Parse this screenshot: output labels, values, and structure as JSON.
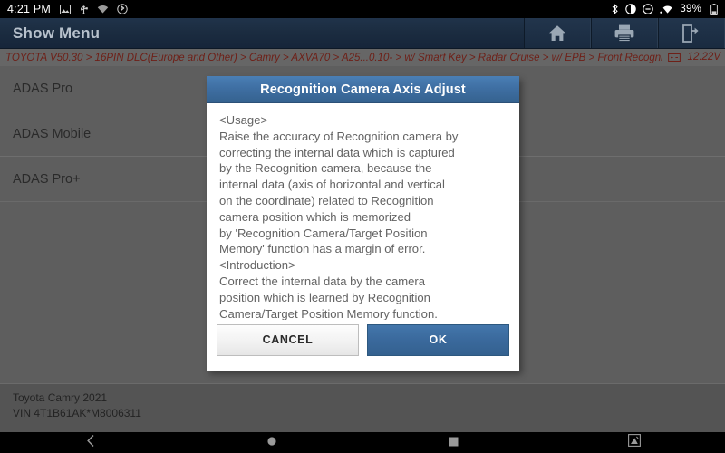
{
  "statusbar": {
    "time": "4:21 PM",
    "left_icons": [
      "image-icon",
      "usb-icon",
      "wifi-icon",
      "bluetooth-circle-icon"
    ],
    "right_icons": [
      "bluetooth-icon",
      "brightness-icon",
      "do-not-disturb-icon",
      "wifi-signal-icon"
    ],
    "battery_percent": "39%",
    "battery_icon": "battery-icon"
  },
  "titlebar": {
    "title": "Show Menu",
    "buttons": [
      {
        "name": "home-button",
        "icon": "home-icon"
      },
      {
        "name": "print-button",
        "icon": "printer-icon"
      },
      {
        "name": "exit-button",
        "icon": "exit-icon"
      }
    ]
  },
  "breadcrumb": {
    "path": "TOYOTA V50.30 > 16PIN DLC(Europe and Other) > Camry > AXVA70 > A25...0.10- > w/ Smart Key > Radar Cruise > w/ EPB > Front Recognition Camera",
    "battery_icon": "car-battery-icon",
    "voltage": "12.22V"
  },
  "menu": {
    "items": [
      {
        "label": "ADAS Pro"
      },
      {
        "label": "ADAS Mobile"
      },
      {
        "label": "ADAS Pro+"
      }
    ]
  },
  "dialog": {
    "title": "Recognition Camera Axis Adjust",
    "message": "<Usage>\nRaise the accuracy of Recognition camera by\ncorrecting the internal data which is captured\nby the Recognition camera, because the\ninternal data (axis of horizontal and vertical\non the coordinate) related to Recognition\ncamera position which is memorized\nby 'Recognition Camera/Target Position\nMemory' function has a margin of error.\n<Introduction>\nCorrect the internal data by the camera\nposition which is learned by Recognition\nCamera/Target Position Memory function.",
    "cancel_label": "CANCEL",
    "ok_label": "OK"
  },
  "footer": {
    "vehicle": "Toyota Camry 2021",
    "vin": "VIN 4T1B61AK*M8006311"
  },
  "navbar": {
    "buttons": [
      {
        "name": "nav-back-button",
        "icon": "chevron-left-icon"
      },
      {
        "name": "nav-home-button",
        "icon": "circle-icon"
      },
      {
        "name": "nav-recents-button",
        "icon": "square-icon"
      },
      {
        "name": "nav-screenshot-button",
        "icon": "screenshot-icon"
      }
    ]
  },
  "colors": {
    "accent_blue": "#3f6fa3",
    "titlebar_navy": "#1b2c40",
    "breadcrumb_text": "#6e2018",
    "page_bg": "#5e5e5e"
  }
}
